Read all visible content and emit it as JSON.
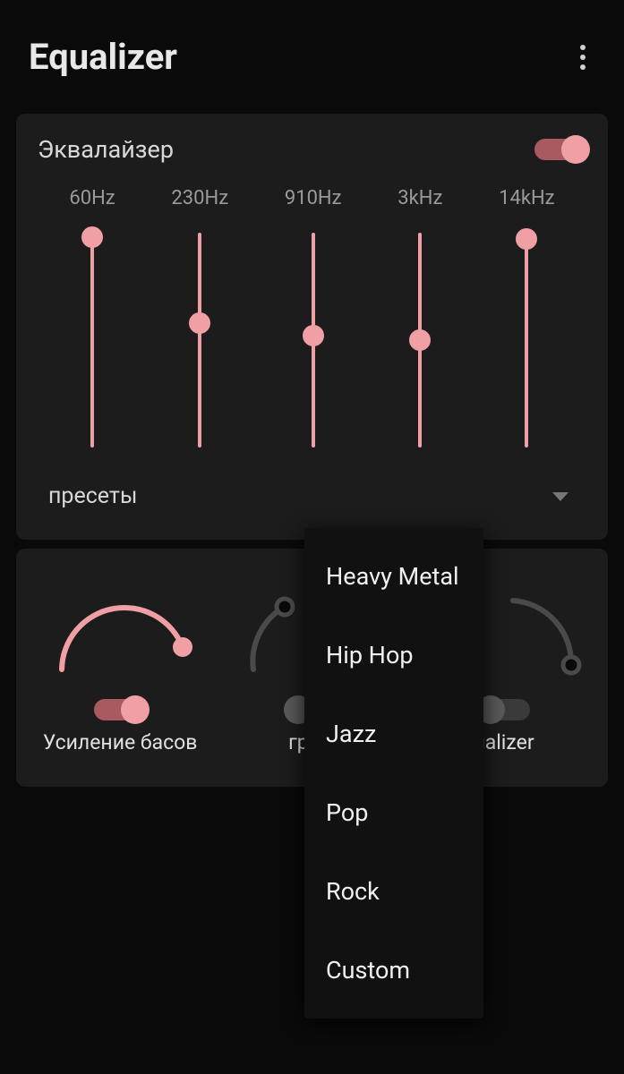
{
  "header": {
    "title": "Equalizer"
  },
  "equalizer_card": {
    "title": "Эквалайзер",
    "enabled": true,
    "bands": [
      {
        "label": "60Hz",
        "value": 0.98
      },
      {
        "label": "230Hz",
        "value": 0.58
      },
      {
        "label": "910Hz",
        "value": 0.52
      },
      {
        "label": "3kHz",
        "value": 0.5
      },
      {
        "label": "14kHz",
        "value": 0.97
      }
    ],
    "preset_label": "пресеты"
  },
  "preset_menu": {
    "items": [
      "Heavy Metal",
      "Hip Hop",
      "Jazz",
      "Pop",
      "Rock",
      "Custom"
    ]
  },
  "knobs": {
    "bass": {
      "label": "Усиление басов",
      "enabled": true,
      "active": true
    },
    "loud": {
      "label": "гром",
      "enabled": false,
      "active": false
    },
    "virt": {
      "label": "ualizer",
      "enabled": false,
      "active": false
    }
  },
  "colors": {
    "accent": "#f0a0a5",
    "accent_dark": "#a85a60",
    "inactive": "#4a4a4a"
  }
}
